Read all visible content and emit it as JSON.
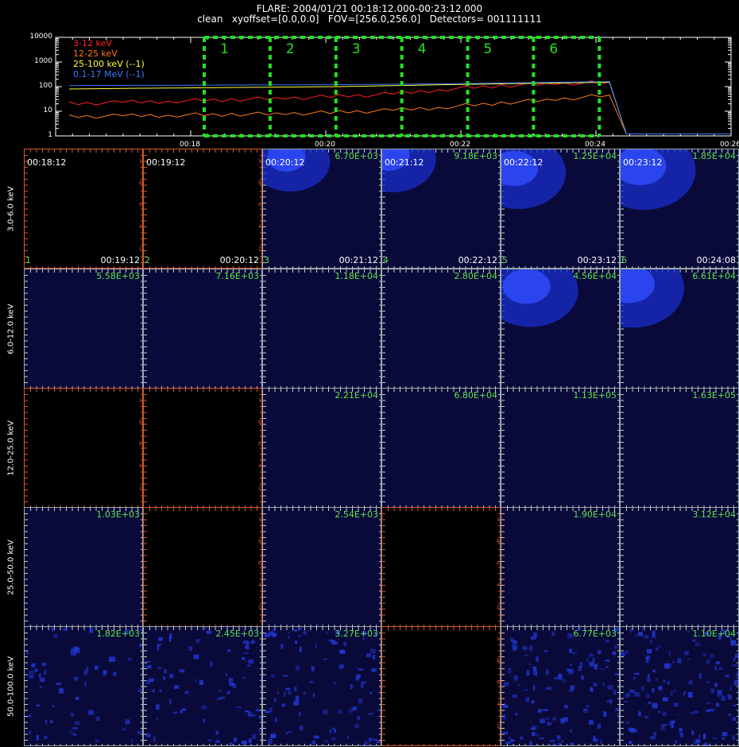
{
  "header": {
    "line1": "FLARE: 2004/01/21 00:18:12.000-00:23:12.000",
    "line2": "clean   xyoffset=[0.0,0.0]   FOV=[256.0,256.0]   Detectors= 001111111"
  },
  "chart_data": {
    "type": "line",
    "x_ticks": [
      "00:18",
      "00:20",
      "00:22",
      "00:24",
      "00:26"
    ],
    "y_ticks": [
      "10000",
      "1000",
      "100",
      "10",
      "1"
    ],
    "y_scale": "log",
    "ylim": [
      1,
      10000
    ],
    "xlim": [
      "00:16:00",
      "00:26:00"
    ],
    "series": [
      {
        "name": "3-12 keV",
        "color": "#ff2020",
        "x": [
          0,
          1,
          2,
          3,
          4,
          5,
          6,
          7,
          8,
          9,
          10
        ],
        "values": [
          20,
          23,
          26,
          30,
          34,
          40,
          50,
          80,
          110,
          130,
          150
        ]
      },
      {
        "name": "12-25 keV",
        "color": "#ff7a1a",
        "x": [
          0,
          1,
          2,
          3,
          4,
          5,
          6,
          7,
          8,
          9,
          10
        ],
        "values": [
          6,
          6.5,
          7,
          7.5,
          8,
          9,
          11,
          15,
          22,
          30,
          45
        ]
      },
      {
        "name": "25-100 keV (--1)",
        "color": "#ffff40",
        "x": [
          0,
          1,
          2,
          3,
          4,
          5,
          6,
          7,
          8,
          9,
          10
        ],
        "values": [
          80,
          85,
          88,
          92,
          96,
          100,
          110,
          120,
          130,
          140,
          150
        ]
      },
      {
        "name": "0.1-17 MeV (--1)",
        "color": "#3a78ff",
        "x": [
          0,
          1,
          2,
          3,
          4,
          5,
          6,
          7,
          8,
          9,
          10
        ],
        "values": [
          110,
          112,
          114,
          116,
          118,
          120,
          125,
          130,
          140,
          150,
          160
        ]
      }
    ],
    "intervals": [
      "1",
      "2",
      "3",
      "4",
      "5",
      "6"
    ]
  },
  "image_grid": {
    "energy_bands": [
      "3.0-6.0 keV",
      "6.0-12.0 keV",
      "12.0-25.0 keV",
      "25.0-50.0 keV",
      "50.0-100.0 keV"
    ],
    "time_starts": [
      "00:18:12",
      "00:19:12",
      "00:20:12",
      "00:21:12",
      "00:22:12",
      "00:23:12"
    ],
    "time_ends": [
      "00:19:12",
      "00:20:12",
      "00:21:12",
      "00:22:12",
      "00:23:12",
      "00:24:08"
    ],
    "interval_labels": [
      "1",
      "2",
      "3",
      "4",
      "5",
      "6"
    ],
    "axis_tick_labels": [
      "2",
      "4",
      "6",
      "8",
      "10"
    ],
    "rows": [
      {
        "maxima": [
          "",
          "",
          "6.70E+03",
          "9.18E+03",
          "1.25E+04",
          "1.85E+04"
        ],
        "empty": [
          true,
          true,
          false,
          false,
          false,
          false
        ]
      },
      {
        "maxima": [
          "5.58E+03",
          "7.16E+03",
          "1.18E+04",
          "2.80E+04",
          "4.56E+04",
          "6.61E+04"
        ],
        "empty": [
          false,
          false,
          false,
          false,
          false,
          false
        ]
      },
      {
        "maxima": [
          "",
          "",
          "2.21E+04",
          "6.80E+04",
          "1.13E+05",
          "1.63E+05"
        ],
        "empty": [
          true,
          true,
          false,
          false,
          false,
          false
        ]
      },
      {
        "maxima": [
          "1.03E+03",
          "",
          "2.54E+03",
          "",
          "1.90E+04",
          "3.12E+04"
        ],
        "empty": [
          false,
          true,
          false,
          true,
          false,
          false
        ]
      },
      {
        "maxima": [
          "1.82E+03",
          "2.45E+03",
          "3.27E+03",
          "",
          "6.77E+03",
          "1.10E+04"
        ],
        "empty": [
          false,
          false,
          false,
          true,
          false,
          false
        ]
      }
    ]
  }
}
